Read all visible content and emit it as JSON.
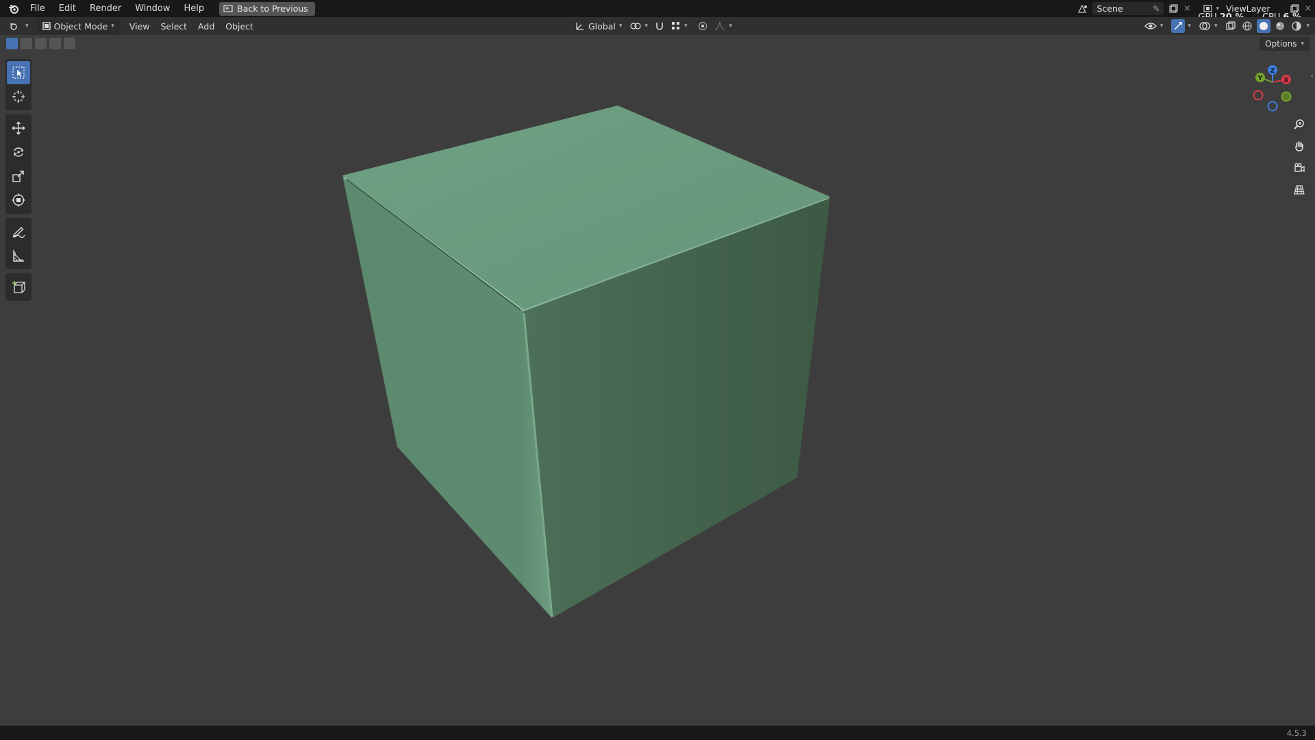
{
  "menu": {
    "items": [
      "File",
      "Edit",
      "Render",
      "Window",
      "Help"
    ],
    "back_button": "Back to Previous"
  },
  "scene": {
    "name": "Scene"
  },
  "view_layer": {
    "name": "ViewLayer"
  },
  "stats": {
    "gpu_label": "GPU",
    "gpu_value": "20 %",
    "cpu_label": "CPU",
    "cpu_value": "6 %"
  },
  "header": {
    "mode": "Object Mode",
    "menus": [
      "View",
      "Select",
      "Add",
      "Object"
    ],
    "orientation": "Global",
    "options": "Options"
  },
  "gizmo": {
    "z": "Z",
    "y": "Y",
    "x": "X"
  },
  "status": {
    "version": "4.5.3"
  },
  "colors": {
    "accent": "#4772b3",
    "cube_top": "#6c9b80",
    "cube_left": "#5e8a6f",
    "cube_right": "#46664f"
  }
}
